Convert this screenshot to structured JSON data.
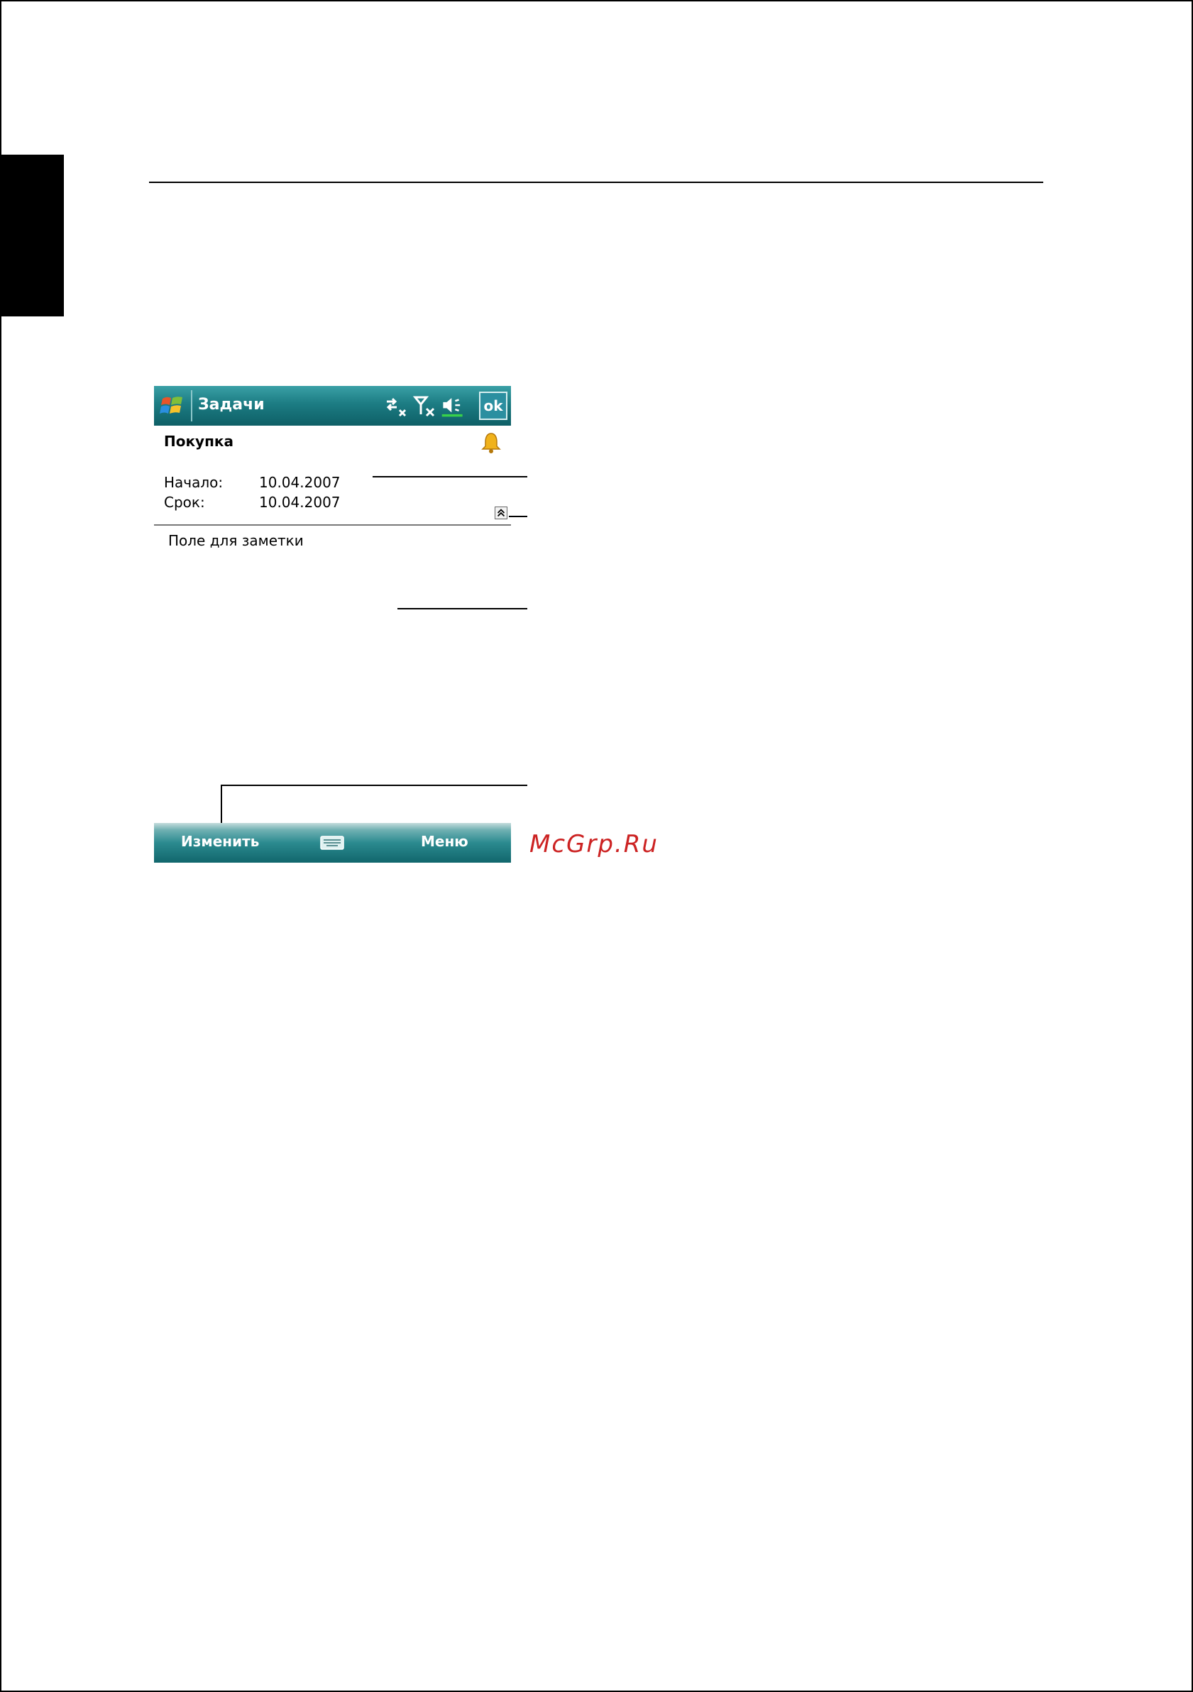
{
  "device": {
    "title_bar": {
      "app_title": "Задачи",
      "ok_label": "ok"
    },
    "task": {
      "name": "Покупка",
      "fields": [
        {
          "label": "Начало:",
          "value": "10.04.2007"
        },
        {
          "label": "Срок:",
          "value": "10.04.2007"
        }
      ],
      "notes_placeholder": "Поле для заметки"
    },
    "softkeys": {
      "left": "Изменить",
      "right": "Меню"
    }
  },
  "watermark": "McGrp.Ru"
}
